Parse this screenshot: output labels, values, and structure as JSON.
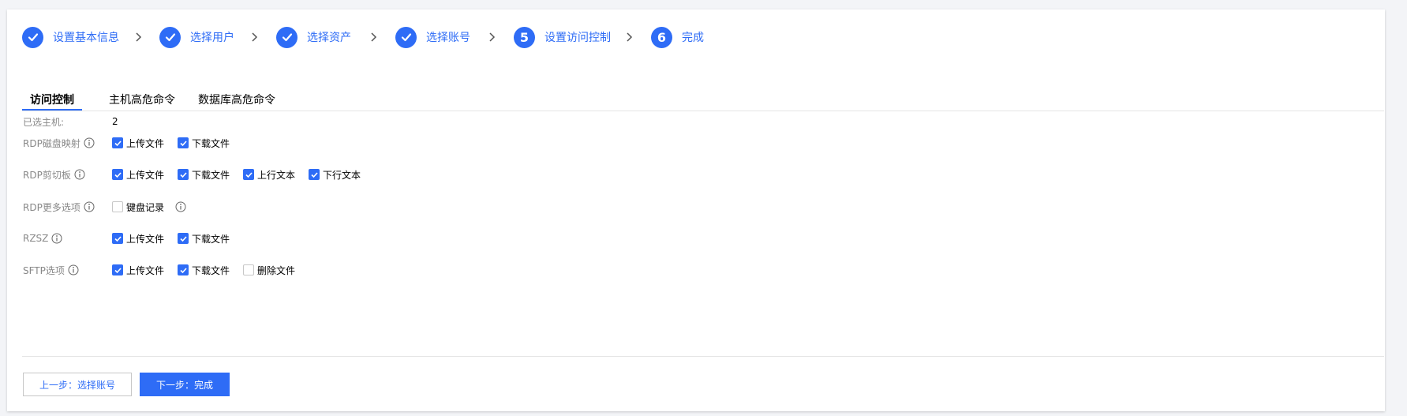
{
  "colors": {
    "accent": "#2e6cf6",
    "label_gray": "#888888"
  },
  "steps": [
    {
      "status": "done",
      "number": "",
      "label": "设置基本信息"
    },
    {
      "status": "done",
      "number": "",
      "label": "选择用户"
    },
    {
      "status": "done",
      "number": "",
      "label": "选择资产"
    },
    {
      "status": "done",
      "number": "",
      "label": "选择账号"
    },
    {
      "status": "current",
      "number": "5",
      "label": "设置访问控制"
    },
    {
      "status": "pending",
      "number": "6",
      "label": "完成"
    }
  ],
  "tabs": [
    {
      "label": "访问控制",
      "active": true
    },
    {
      "label": "主机高危命令",
      "active": false
    },
    {
      "label": "数据库高危命令",
      "active": false
    }
  ],
  "form": {
    "selected_hosts": {
      "label": "已选主机:",
      "value": "2"
    },
    "rdp_disk": {
      "label": "RDP磁盘映射",
      "options": [
        {
          "label": "上传文件",
          "checked": true
        },
        {
          "label": "下载文件",
          "checked": true
        }
      ]
    },
    "rdp_clipboard": {
      "label": "RDP剪切板",
      "options": [
        {
          "label": "上传文件",
          "checked": true
        },
        {
          "label": "下载文件",
          "checked": true
        },
        {
          "label": "上行文本",
          "checked": true
        },
        {
          "label": "下行文本",
          "checked": true
        }
      ]
    },
    "rdp_more": {
      "label": "RDP更多选项",
      "options": [
        {
          "label": "键盘记录",
          "checked": false
        }
      ]
    },
    "rzsz": {
      "label": "RZSZ",
      "options": [
        {
          "label": "上传文件",
          "checked": true
        },
        {
          "label": "下载文件",
          "checked": true
        }
      ]
    },
    "sftp": {
      "label": "SFTP选项",
      "options": [
        {
          "label": "上传文件",
          "checked": true
        },
        {
          "label": "下载文件",
          "checked": true
        },
        {
          "label": "删除文件",
          "checked": false
        }
      ]
    }
  },
  "footer": {
    "prev_label": "上一步：选择账号",
    "next_label": "下一步：完成"
  }
}
